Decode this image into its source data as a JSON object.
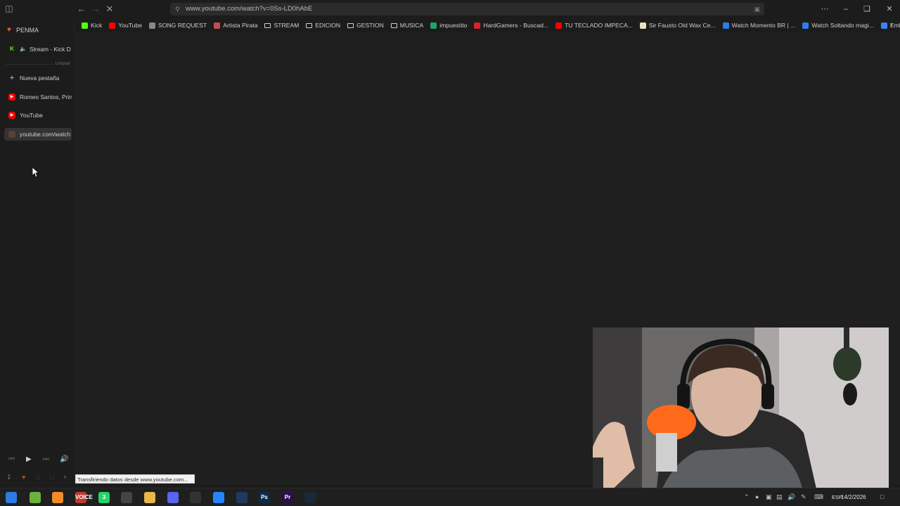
{
  "browser": {
    "url": "www.youtube.com/watch?v=0Ss-LD0hAbE",
    "status_text": "Transfiriendo datos desde www.youtube.com..."
  },
  "bookmarks": [
    {
      "label": "Kick",
      "icon": "kick-icon",
      "color": "#53fc18"
    },
    {
      "label": "YouTube",
      "icon": "youtube-icon",
      "color": "#ff0000"
    },
    {
      "label": "SONG REQUEST",
      "icon": "song-request-icon",
      "color": "#888888"
    },
    {
      "label": "Artista Pirata",
      "icon": "artista-pirata-icon",
      "color": "#c0504d"
    },
    {
      "label": "STREAM",
      "icon": "folder-icon",
      "color": "#cfcfcf"
    },
    {
      "label": "EDICION",
      "icon": "folder-icon",
      "color": "#cfcfcf"
    },
    {
      "label": "GESTION",
      "icon": "folder-icon",
      "color": "#cfcfcf"
    },
    {
      "label": "MUSICA",
      "icon": "folder-icon",
      "color": "#cfcfcf"
    },
    {
      "label": "impuestito",
      "icon": "sheets-icon",
      "color": "#1fa463"
    },
    {
      "label": "HardGamers - Buscad...",
      "icon": "hardgamers-icon",
      "color": "#d8232a"
    },
    {
      "label": "TU TECLADO IMPECA...",
      "icon": "youtube-icon",
      "color": "#ff0000"
    },
    {
      "label": "Sir Fausto Old Wax Ce...",
      "icon": "wax-icon",
      "color": "#e8e0c0"
    },
    {
      "label": "Watch Momento BR | ...",
      "icon": "watch-icon",
      "color": "#2b7de9"
    },
    {
      "label": "Watch Soltando magi...",
      "icon": "watch-icon",
      "color": "#2b7de9"
    },
    {
      "label": "Embed Generator",
      "icon": "embed-generator-icon",
      "color": "#3b82f6"
    }
  ],
  "sidebar": {
    "workspace": "PENMA",
    "pinned_tab": "Stream - Kick D",
    "clear_label": "Limpiar",
    "new_tab": "Nueva pestaña",
    "tabs": [
      {
        "label": "Romeo Santos, Prin",
        "icon": "youtube-icon"
      },
      {
        "label": "YouTube",
        "icon": "youtube-icon"
      },
      {
        "label": "youtube.com/watch",
        "icon": "loading-icon"
      }
    ]
  },
  "taskbar": {
    "date": "14/2/2026",
    "language": "ESP",
    "apps": [
      {
        "name": "windows-start-icon",
        "label": "",
        "color": "#2d7be5"
      },
      {
        "name": "utorrent-icon",
        "label": "",
        "color": "#6bb33f"
      },
      {
        "name": "fl-studio-icon",
        "label": "",
        "color": "#f28c28"
      },
      {
        "name": "voicemeeter-icon",
        "label": "VOICE",
        "color": "#c0392b"
      },
      {
        "name": "whatsapp-icon",
        "label": "3",
        "color": "#25d366"
      },
      {
        "name": "obs-icon",
        "label": "",
        "color": "#444444"
      },
      {
        "name": "file-explorer-icon",
        "label": "",
        "color": "#e8b64a"
      },
      {
        "name": "discord-icon",
        "label": "",
        "color": "#5865f2"
      },
      {
        "name": "speedtest-icon",
        "label": "",
        "color": "#333333"
      },
      {
        "name": "sourcetree-icon",
        "label": "",
        "color": "#2684ff"
      },
      {
        "name": "audition-icon",
        "label": "",
        "color": "#1f3a5f"
      },
      {
        "name": "photoshop-icon",
        "label": "Ps",
        "color": "#0a2b4d"
      },
      {
        "name": "premiere-icon",
        "label": "Pr",
        "color": "#2a0f4d"
      },
      {
        "name": "steam-icon",
        "label": "",
        "color": "#1b2838"
      }
    ]
  }
}
